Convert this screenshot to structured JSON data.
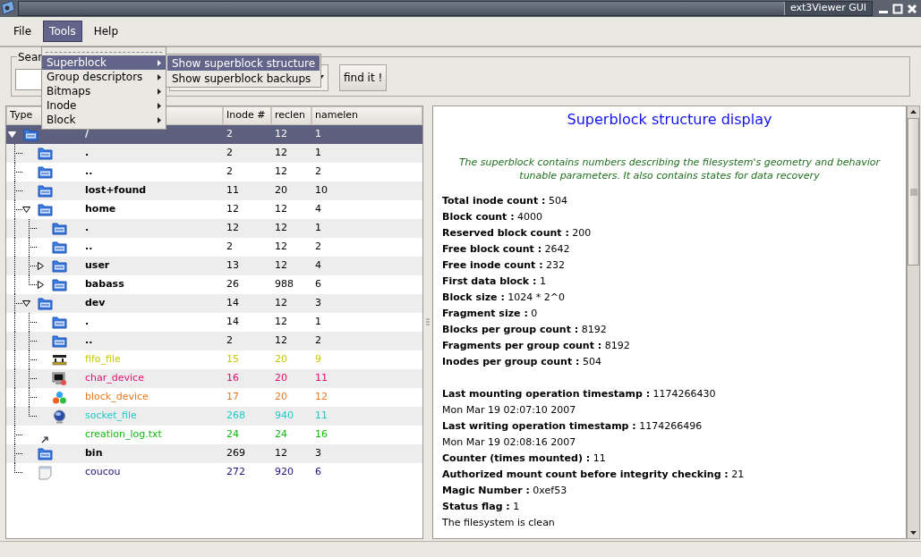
{
  "window": {
    "title": "ext3Viewer GUI"
  },
  "menubar": [
    {
      "label": "File",
      "selected": false
    },
    {
      "label": "Tools",
      "selected": true
    },
    {
      "label": "Help",
      "selected": false
    }
  ],
  "tools_menu": [
    {
      "label": "Superblock",
      "selected": true
    },
    {
      "label": "Group descriptors",
      "selected": false
    },
    {
      "label": "Bitmaps",
      "selected": false
    },
    {
      "label": "Inode",
      "selected": false
    },
    {
      "label": "Block",
      "selected": false
    }
  ],
  "submenu": [
    {
      "label": "Show superblock structure",
      "selected": true
    },
    {
      "label": "Show superblock backups",
      "selected": false
    }
  ],
  "search": {
    "legend": "Sear",
    "button": "find it !"
  },
  "tree": {
    "columns": [
      {
        "label": "Type"
      },
      {
        "label": "Inode #"
      },
      {
        "label": "reclen"
      },
      {
        "label": "namelen"
      }
    ],
    "rows": [
      {
        "name": "/",
        "inode": "2",
        "reclen": "12",
        "namelen": "1",
        "kind": "folder",
        "selected": true,
        "expanded": true,
        "children": [
          {
            "name": ".",
            "inode": "2",
            "reclen": "12",
            "namelen": "1",
            "kind": "folder",
            "selected": false
          },
          {
            "name": "..",
            "inode": "2",
            "reclen": "12",
            "namelen": "2",
            "kind": "folder",
            "selected": false
          },
          {
            "name": "lost+found",
            "inode": "11",
            "reclen": "20",
            "namelen": "10",
            "kind": "folder",
            "selected": false
          },
          {
            "name": "home",
            "inode": "12",
            "reclen": "12",
            "namelen": "4",
            "kind": "folder",
            "selected": false,
            "expanded": true,
            "children": [
              {
                "name": ".",
                "inode": "12",
                "reclen": "12",
                "namelen": "1",
                "kind": "folder",
                "selected": false
              },
              {
                "name": "..",
                "inode": "2",
                "reclen": "12",
                "namelen": "2",
                "kind": "folder",
                "selected": false
              },
              {
                "name": "user",
                "inode": "13",
                "reclen": "12",
                "namelen": "4",
                "kind": "folder",
                "selected": false,
                "expanded": false
              },
              {
                "name": "babass",
                "inode": "26",
                "reclen": "988",
                "namelen": "6",
                "kind": "folder",
                "selected": false,
                "expanded": false
              }
            ]
          },
          {
            "name": "dev",
            "inode": "14",
            "reclen": "12",
            "namelen": "3",
            "kind": "folder",
            "selected": false,
            "expanded": true,
            "children": [
              {
                "name": ".",
                "inode": "14",
                "reclen": "12",
                "namelen": "1",
                "kind": "folder",
                "selected": false
              },
              {
                "name": "..",
                "inode": "2",
                "reclen": "12",
                "namelen": "2",
                "kind": "folder",
                "selected": false
              },
              {
                "name": "fifo_file",
                "inode": "15",
                "reclen": "20",
                "namelen": "9",
                "kind": "fifo",
                "color": "#c8c800",
                "selected": false
              },
              {
                "name": "char_device",
                "inode": "16",
                "reclen": "20",
                "namelen": "11",
                "kind": "char",
                "color": "#e0106a",
                "selected": false
              },
              {
                "name": "block_device",
                "inode": "17",
                "reclen": "20",
                "namelen": "12",
                "kind": "block",
                "color": "#e87820",
                "selected": false
              },
              {
                "name": "socket_file",
                "inode": "268",
                "reclen": "940",
                "namelen": "11",
                "kind": "socket",
                "color": "#20c8c8",
                "selected": false
              }
            ]
          },
          {
            "name": "creation_log.txt",
            "inode": "24",
            "reclen": "24",
            "namelen": "16",
            "kind": "symlink",
            "color": "#10b810",
            "selected": false
          },
          {
            "name": "bin",
            "inode": "269",
            "reclen": "12",
            "namelen": "3",
            "kind": "folder",
            "selected": false
          },
          {
            "name": "coucou",
            "inode": "272",
            "reclen": "920",
            "namelen": "6",
            "kind": "file",
            "color": "#201080",
            "selected": false
          }
        ]
      }
    ]
  },
  "details": {
    "title": "Superblock structure display",
    "description": "The superblock contains numbers describing the filesystem's geometry and behavior tunable parameters. It also contains states for data recovery",
    "sections": [
      [
        {
          "kind": "field",
          "label": "Total inode count :",
          "value": "504"
        },
        {
          "kind": "field",
          "label": "Block count :",
          "value": "4000"
        },
        {
          "kind": "field",
          "label": "Reserved block count :",
          "value": "200"
        },
        {
          "kind": "field",
          "label": "Free block count :",
          "value": "2642"
        },
        {
          "kind": "field",
          "label": "Free inode count :",
          "value": "232"
        },
        {
          "kind": "field",
          "label": "First data block :",
          "value": "1"
        },
        {
          "kind": "field",
          "label": "Block size :",
          "value": "1024 * 2^0"
        },
        {
          "kind": "field",
          "label": "Fragment size :",
          "value": "0"
        },
        {
          "kind": "field",
          "label": "Blocks per group count :",
          "value": "8192"
        },
        {
          "kind": "field",
          "label": "Fragments per group count :",
          "value": "8192"
        },
        {
          "kind": "field",
          "label": "Inodes per group count :",
          "value": "504"
        }
      ],
      [
        {
          "kind": "field",
          "label": "Last mounting operation timestamp :",
          "value": "1174266430"
        },
        {
          "kind": "text",
          "text": "Mon Mar 19 02:07:10 2007"
        },
        {
          "kind": "field",
          "label": "Last writing operation timestamp :",
          "value": "1174266496"
        },
        {
          "kind": "text",
          "text": "Mon Mar 19 02:08:16 2007"
        },
        {
          "kind": "field",
          "label": "Counter (times mounted) :",
          "value": "11"
        },
        {
          "kind": "field",
          "label": "Authorized mount count before integrity checking :",
          "value": "21"
        },
        {
          "kind": "field",
          "label": "Magic Number :",
          "value": "0xef53"
        },
        {
          "kind": "field",
          "label": "Status flag :",
          "value": "1"
        },
        {
          "kind": "text",
          "text": "The filesystem is clean"
        }
      ]
    ]
  }
}
